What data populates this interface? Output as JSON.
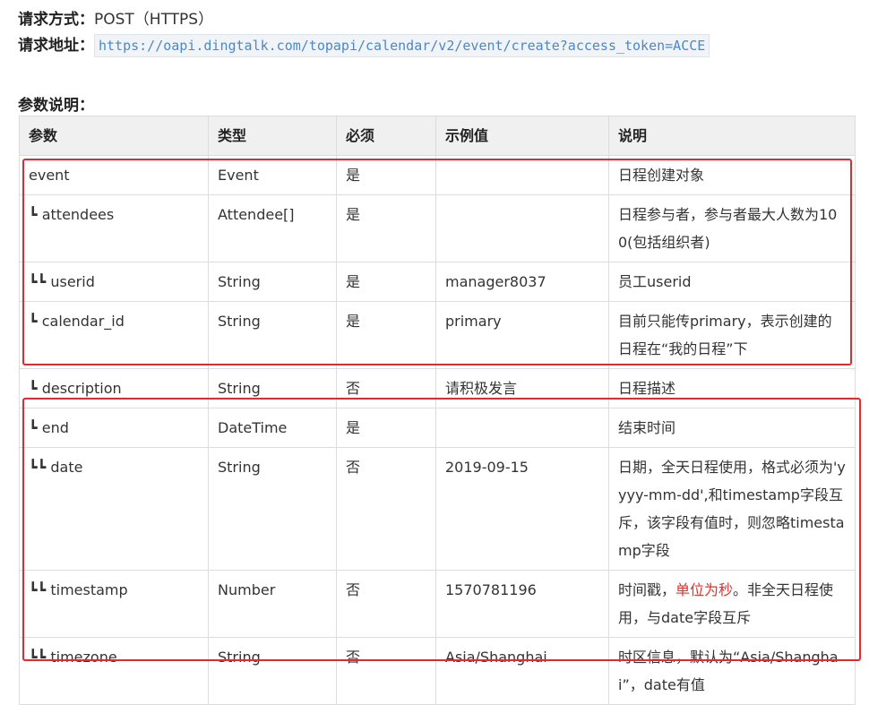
{
  "request": {
    "method_label": "请求方式：",
    "method": "POST（HTTPS）",
    "url_label": "请求地址：",
    "url": "https://oapi.dingtalk.com/topapi/calendar/v2/event/create?access_token=ACCE"
  },
  "params_title": "参数说明：",
  "table": {
    "headers": [
      "参数",
      "类型",
      "必须",
      "示例值",
      "说明"
    ],
    "rows": [
      {
        "param": "event",
        "type": "Event",
        "required": "是",
        "example": "",
        "desc": "日程创建对象"
      },
      {
        "param": "┗ attendees",
        "type": "Attendee[]",
        "required": "是",
        "example": "",
        "desc": "日程参与者，参与者最大人数为100(包括组织者)"
      },
      {
        "param": "┗┗ userid",
        "type": "String",
        "required": "是",
        "example": "manager8037",
        "desc": "员工userid"
      },
      {
        "param": "┗ calendar_id",
        "type": "String",
        "required": "是",
        "example": "primary",
        "desc": "目前只能传primary，表示创建的日程在“我的日程”下"
      },
      {
        "param": "┗ description",
        "type": "String",
        "required": "否",
        "example": "请积极发言",
        "desc": "日程描述"
      },
      {
        "param": "┗ end",
        "type": "DateTime",
        "required": "是",
        "example": "",
        "desc": "结束时间"
      },
      {
        "param": "┗┗ date",
        "type": "String",
        "required": "否",
        "example": "2019-09-15",
        "desc": "日期，全天日程使用，格式必须为'yyyy-mm-dd',和timestamp字段互斥，该字段有值时，则忽略timestamp字段"
      },
      {
        "param": "┗┗ timestamp",
        "type": "Number",
        "required": "否",
        "example": "1570781196",
        "desc_pre": "时间戳，",
        "desc_red": "单位为秒",
        "desc_post": "。非全天日程使用，与date字段互斥"
      },
      {
        "param": "┗┗ timezone",
        "type": "String",
        "required": "否",
        "example": "Asia/Shanghai",
        "desc": "时区信息，默认为“Asia/Shanghai”，date有值"
      }
    ]
  },
  "colors": {
    "highlight": "#e8282b",
    "link": "#4d87c7",
    "emphasis": "#e0312c"
  }
}
